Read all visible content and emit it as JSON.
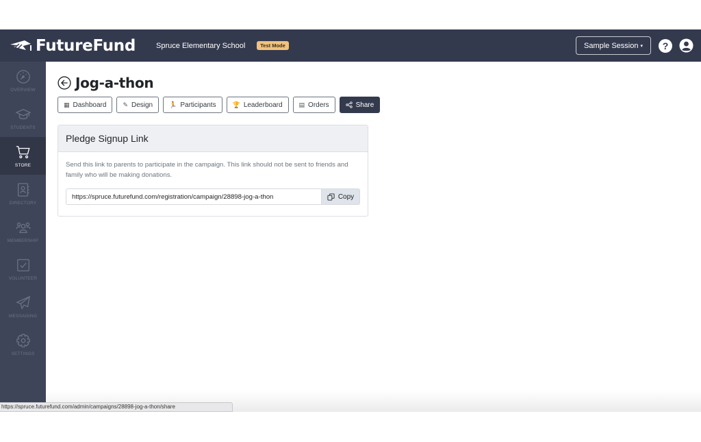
{
  "topbar": {
    "brand": "FutureFund",
    "school_name": "Spruce Elementary School",
    "mode_badge": "Test Mode",
    "session_label": "Sample Session",
    "session_caret": "▾",
    "help_label": "?",
    "colors": {
      "bar": "#343a4e",
      "badge": "#f1c27d"
    }
  },
  "sidebar": {
    "items": [
      {
        "label": "OVERVIEW",
        "icon": "dashboard-gauge-icon",
        "active": false
      },
      {
        "label": "STUDENTS",
        "icon": "graduation-cap-icon",
        "active": false
      },
      {
        "label": "STORE",
        "icon": "shopping-cart-icon",
        "active": true
      },
      {
        "label": "DIRECTORY",
        "icon": "contact-book-icon",
        "active": false
      },
      {
        "label": "MEMBERSHIP",
        "icon": "people-group-icon",
        "active": false
      },
      {
        "label": "VOLUNTEER",
        "icon": "checkbox-icon",
        "active": false
      },
      {
        "label": "MESSAGING",
        "icon": "paper-plane-icon",
        "active": false
      },
      {
        "label": "SETTINGS",
        "icon": "gear-icon",
        "active": false
      }
    ]
  },
  "page": {
    "title": "Jog-a-thon",
    "tabs": [
      {
        "label": "Dashboard",
        "icon": "▦",
        "active": false
      },
      {
        "label": "Design",
        "icon": "✎",
        "active": false
      },
      {
        "label": "Participants",
        "icon": "🏃",
        "active": false
      },
      {
        "label": "Leaderboard",
        "icon": "🏆",
        "active": false
      },
      {
        "label": "Orders",
        "icon": "▤",
        "active": false
      },
      {
        "label": "Share",
        "icon": "⋖",
        "active": true
      }
    ]
  },
  "card": {
    "title": "Pledge Signup Link",
    "description": "Send this link to parents to participate in the campaign. This link should not be sent to friends and family who will be making donations.",
    "link_value": "https://spruce.futurefund.com/registration/campaign/28898-jog-a-thon",
    "copy_label": "Copy"
  },
  "status_bar": {
    "url": "https://spruce.futurefund.com/admin/campaigns/28898-jog-a-thon/share"
  }
}
